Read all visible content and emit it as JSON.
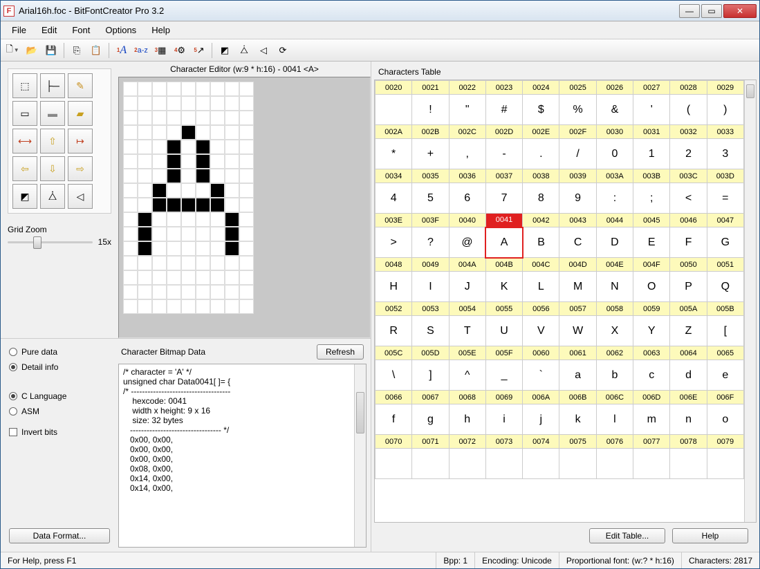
{
  "window": {
    "title": "Arial16h.foc - BitFontCreator Pro 3.2"
  },
  "menu": {
    "file": "File",
    "edit": "Edit",
    "font": "Font",
    "options": "Options",
    "help": "Help"
  },
  "toolbar": {
    "new": "New",
    "open": "Open",
    "save": "Save",
    "copy": "Copy",
    "paste": "Paste",
    "t1": "A",
    "t2": "a-z",
    "t3": "Grid",
    "t4": "Opt",
    "t5": "Exp",
    "invert": "Invert",
    "flip": "Flip",
    "flipv": "FlipV",
    "rot": "Rotate"
  },
  "editor": {
    "header": "Character Editor (w:9 * h:16) - 0041 <A>",
    "width": 9,
    "height": 16,
    "pixels": [
      [
        0,
        0,
        0,
        0,
        0,
        0,
        0,
        0,
        0
      ],
      [
        0,
        0,
        0,
        0,
        0,
        0,
        0,
        0,
        0
      ],
      [
        0,
        0,
        0,
        0,
        0,
        0,
        0,
        0,
        0
      ],
      [
        0,
        0,
        0,
        0,
        1,
        0,
        0,
        0,
        0
      ],
      [
        0,
        0,
        0,
        1,
        0,
        1,
        0,
        0,
        0
      ],
      [
        0,
        0,
        0,
        1,
        0,
        1,
        0,
        0,
        0
      ],
      [
        0,
        0,
        0,
        1,
        0,
        1,
        0,
        0,
        0
      ],
      [
        0,
        0,
        1,
        0,
        0,
        0,
        1,
        0,
        0
      ],
      [
        0,
        0,
        1,
        1,
        1,
        1,
        1,
        0,
        0
      ],
      [
        0,
        1,
        0,
        0,
        0,
        0,
        0,
        1,
        0
      ],
      [
        0,
        1,
        0,
        0,
        0,
        0,
        0,
        1,
        0
      ],
      [
        0,
        1,
        0,
        0,
        0,
        0,
        0,
        1,
        0
      ],
      [
        0,
        0,
        0,
        0,
        0,
        0,
        0,
        0,
        0
      ],
      [
        0,
        0,
        0,
        0,
        0,
        0,
        0,
        0,
        0
      ],
      [
        0,
        0,
        0,
        0,
        0,
        0,
        0,
        0,
        0
      ],
      [
        0,
        0,
        0,
        0,
        0,
        0,
        0,
        0,
        0
      ]
    ]
  },
  "zoom": {
    "label": "Grid Zoom",
    "value": "15x"
  },
  "bitmap": {
    "header": "Character Bitmap Data",
    "refresh": "Refresh",
    "opt_pure": "Pure data",
    "opt_detail": "Detail info",
    "opt_c": "C Language",
    "opt_asm": "ASM",
    "opt_invert": "Invert bits",
    "btn_format": "Data Format...",
    "text": "/* character = 'A' */\nunsigned char Data0041[ ]= {\n/* ------------------------------------\n    hexcode: 0041\n    width x height: 9 x 16\n    size: 32 bytes\n   --------------------------------- */\n   0x00, 0x00,\n   0x00, 0x00,\n   0x00, 0x00,\n   0x08, 0x00,\n   0x14, 0x00,\n   0x14, 0x00,"
  },
  "charsTable": {
    "header": "Characters Table",
    "edit": "Edit Table...",
    "help": "Help",
    "selected": "0041",
    "rows": [
      {
        "codes": [
          "0020",
          "0021",
          "0022",
          "0023",
          "0024",
          "0025",
          "0026",
          "0027",
          "0028",
          "0029"
        ],
        "glyphs": [
          " ",
          "!",
          "\"",
          "#",
          "$",
          "%",
          "&",
          "'",
          "(",
          ")"
        ]
      },
      {
        "codes": [
          "002A",
          "002B",
          "002C",
          "002D",
          "002E",
          "002F",
          "0030",
          "0031",
          "0032",
          "0033"
        ],
        "glyphs": [
          "*",
          "+",
          ",",
          "-",
          ".",
          "/",
          "0",
          "1",
          "2",
          "3"
        ]
      },
      {
        "codes": [
          "0034",
          "0035",
          "0036",
          "0037",
          "0038",
          "0039",
          "003A",
          "003B",
          "003C",
          "003D"
        ],
        "glyphs": [
          "4",
          "5",
          "6",
          "7",
          "8",
          "9",
          ":",
          ";",
          "<",
          "="
        ]
      },
      {
        "codes": [
          "003E",
          "003F",
          "0040",
          "0041",
          "0042",
          "0043",
          "0044",
          "0045",
          "0046",
          "0047"
        ],
        "glyphs": [
          ">",
          "?",
          "@",
          "A",
          "B",
          "C",
          "D",
          "E",
          "F",
          "G"
        ]
      },
      {
        "codes": [
          "0048",
          "0049",
          "004A",
          "004B",
          "004C",
          "004D",
          "004E",
          "004F",
          "0050",
          "0051"
        ],
        "glyphs": [
          "H",
          "I",
          "J",
          "K",
          "L",
          "M",
          "N",
          "O",
          "P",
          "Q"
        ]
      },
      {
        "codes": [
          "0052",
          "0053",
          "0054",
          "0055",
          "0056",
          "0057",
          "0058",
          "0059",
          "005A",
          "005B"
        ],
        "glyphs": [
          "R",
          "S",
          "T",
          "U",
          "V",
          "W",
          "X",
          "Y",
          "Z",
          "["
        ]
      },
      {
        "codes": [
          "005C",
          "005D",
          "005E",
          "005F",
          "0060",
          "0061",
          "0062",
          "0063",
          "0064",
          "0065"
        ],
        "glyphs": [
          "\\",
          "]",
          "^",
          "_",
          "`",
          "a",
          "b",
          "c",
          "d",
          "e"
        ]
      },
      {
        "codes": [
          "0066",
          "0067",
          "0068",
          "0069",
          "006A",
          "006B",
          "006C",
          "006D",
          "006E",
          "006F"
        ],
        "glyphs": [
          "f",
          "g",
          "h",
          "i",
          "j",
          "k",
          "l",
          "m",
          "n",
          "o"
        ]
      },
      {
        "codes": [
          "0070",
          "0071",
          "0072",
          "0073",
          "0074",
          "0075",
          "0076",
          "0077",
          "0078",
          "0079"
        ],
        "glyphs": [
          "",
          "",
          "",
          "",
          "",
          "",
          "",
          "",
          "",
          ""
        ]
      }
    ]
  },
  "status": {
    "help": "For Help, press F1",
    "bpp": "Bpp: 1",
    "enc": "Encoding: Unicode",
    "font": "Proportional font: (w:? * h:16)",
    "chars": "Characters: 2817"
  }
}
